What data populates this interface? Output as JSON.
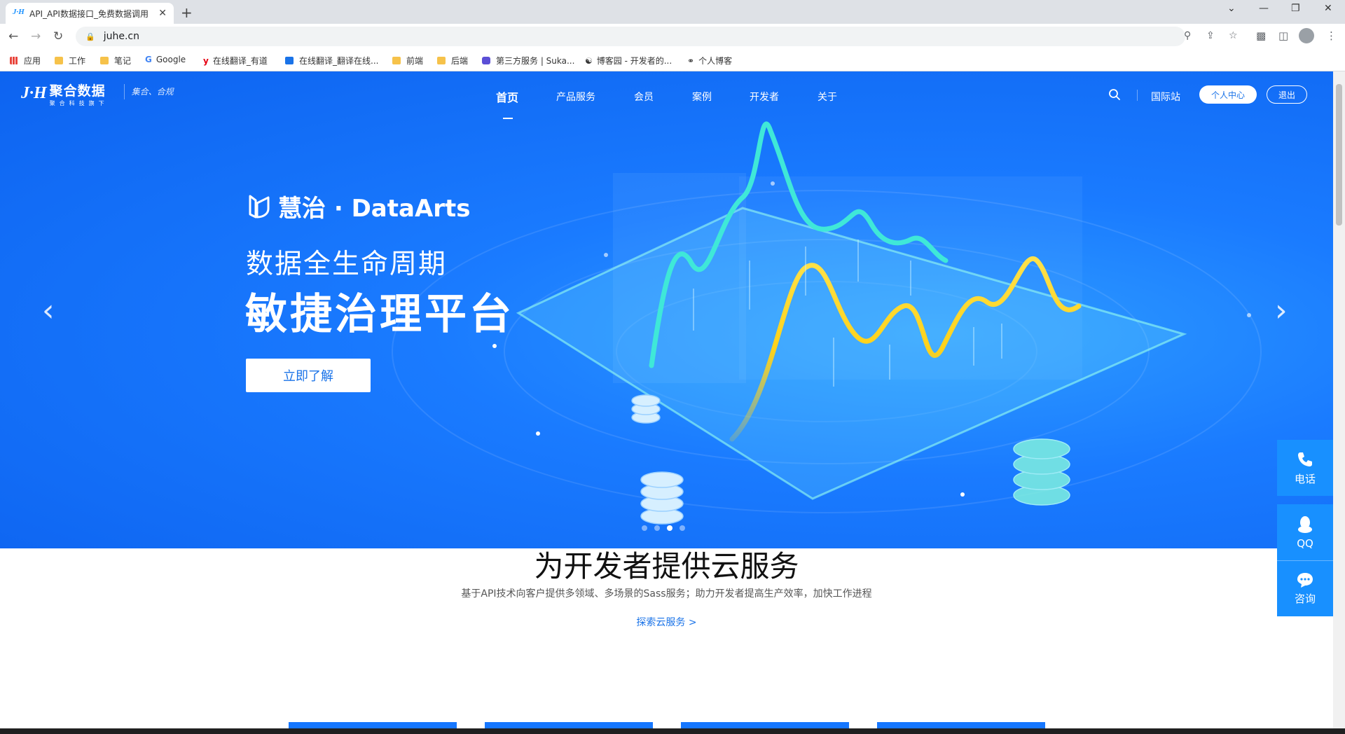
{
  "browser": {
    "tab_title": "API_API数据接口_免费数据调用",
    "tab_favicon": "J·H",
    "tab_close": "✕",
    "new_tab": "+",
    "url": "juhe.cn",
    "window_controls": [
      "⌄",
      "—",
      "❐",
      "✕"
    ]
  },
  "bookmarks": [
    {
      "label": "应用",
      "icon": "apps-grid-icon"
    },
    {
      "label": "工作",
      "icon": "folder-icon"
    },
    {
      "label": "笔记",
      "icon": "folder-icon"
    },
    {
      "label": "Google",
      "icon": "google-icon"
    },
    {
      "label": "在线翻译_有道",
      "icon": "youdao-icon"
    },
    {
      "label": "在线翻译_翻译在线...",
      "icon": "translate-icon"
    },
    {
      "label": "前端",
      "icon": "folder-icon"
    },
    {
      "label": "后端",
      "icon": "folder-icon"
    },
    {
      "label": "第三方服务 | Suka...",
      "icon": "shield-icon"
    },
    {
      "label": "博客园 - 开发者的...",
      "icon": "blog-icon"
    },
    {
      "label": "个人博客",
      "icon": "link-icon"
    }
  ],
  "site": {
    "logo_mark": "J·H",
    "logo_name": "聚合数据",
    "logo_sub": "聚合科技旗下",
    "logo_slogan": "集合、合规",
    "nav": [
      {
        "label": "首页",
        "active": true
      },
      {
        "label": "产品服务",
        "active": false
      },
      {
        "label": "会员",
        "active": false
      },
      {
        "label": "案例",
        "active": false
      },
      {
        "label": "开发者",
        "active": false
      },
      {
        "label": "关于",
        "active": false
      }
    ],
    "intl_label": "国际站",
    "user_center": "个人中心",
    "logout": "退出"
  },
  "hero": {
    "brand": "慧治 · DataArts",
    "subtitle": "数据全生命周期",
    "title": "敏捷治理平台",
    "cta": "立即了解",
    "prev": "‹",
    "next": "›",
    "slides_total": 4,
    "active_slide": 3
  },
  "float_panel": {
    "phone": "电话",
    "qq": "QQ",
    "consult": "咨询"
  },
  "section": {
    "title": "为开发者提供云服务",
    "desc": "基于API技术向客户提供多领域、多场景的Sass服务；助力开发者提高生产效率，加快工作进程",
    "link": "探索云服务 >"
  },
  "colors": {
    "hero_blue": "#1a7bff",
    "accent": "#1890ff",
    "chart_cyan": "#3fe8d8",
    "chart_yellow": "#ffd21a"
  }
}
